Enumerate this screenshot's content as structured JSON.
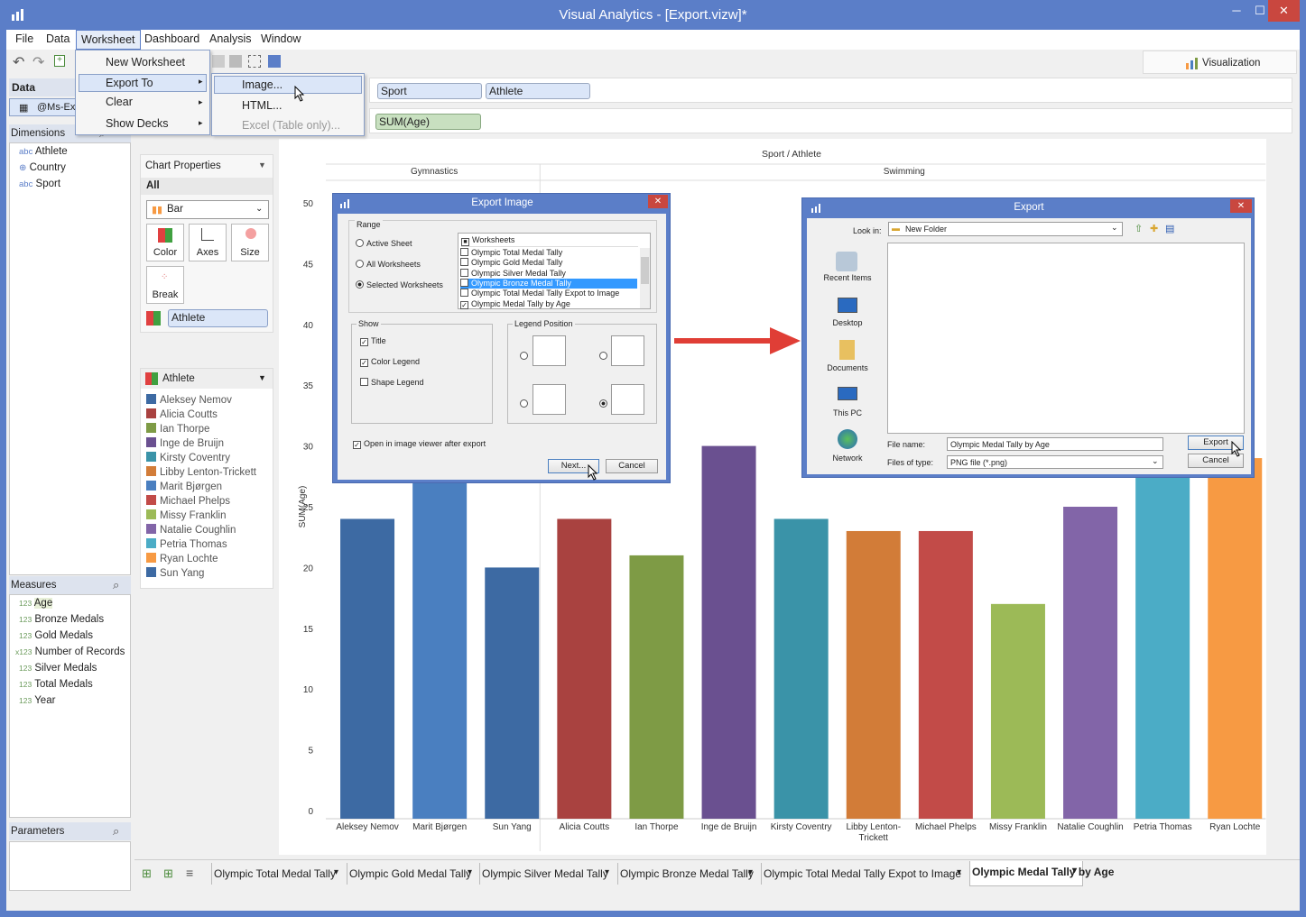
{
  "window": {
    "title": "Visual Analytics - [Export.vizw]*",
    "min": "─",
    "max": "☐",
    "close": "✕"
  },
  "menubar": [
    "File",
    "Data",
    "Worksheet",
    "Dashboard",
    "Analysis",
    "Window"
  ],
  "worksheet_menu": {
    "items": [
      "New Worksheet",
      "Export To",
      "Clear",
      "Show Decks"
    ]
  },
  "export_submenu": {
    "items": [
      "Image...",
      "HTML...",
      "Excel (Table only)..."
    ]
  },
  "visualization_tab": "Visualization",
  "data_panel": {
    "title": "Data",
    "source": "@Ms-Exc"
  },
  "dimensions": {
    "title": "Dimensions",
    "items": [
      {
        "prefix": "abc",
        "label": "Athlete"
      },
      {
        "prefix": "⊕",
        "label": "Country"
      },
      {
        "prefix": "abc",
        "label": "Sport"
      }
    ]
  },
  "measures": {
    "title": "Measures",
    "items": [
      {
        "prefix": "123",
        "label": "Age"
      },
      {
        "prefix": "123",
        "label": "Bronze Medals"
      },
      {
        "prefix": "123",
        "label": "Gold Medals"
      },
      {
        "prefix": "x123",
        "label": "Number of Records"
      },
      {
        "prefix": "123",
        "label": "Silver Medals"
      },
      {
        "prefix": "123",
        "label": "Total Medals"
      },
      {
        "prefix": "123",
        "label": "Year"
      }
    ]
  },
  "parameters": {
    "title": "Parameters"
  },
  "shelves": {
    "columns": [
      "Sport",
      "Athlete"
    ],
    "rows": [
      "SUM(Age)"
    ]
  },
  "chart_properties": {
    "title": "Chart Properties",
    "all": "All",
    "chart_type": "Bar",
    "buttons": [
      "Color",
      "Axes",
      "Size",
      "Break"
    ],
    "color_field": "Athlete"
  },
  "legend": {
    "title": "Athlete",
    "items": [
      {
        "name": "Aleksey Nemov",
        "color": "#3d6aa3"
      },
      {
        "name": "Alicia Coutts",
        "color": "#a94240"
      },
      {
        "name": "Ian Thorpe",
        "color": "#7e9b45"
      },
      {
        "name": "Inge de Bruijn",
        "color": "#6a5090"
      },
      {
        "name": "Kirsty Coventry",
        "color": "#3a93a8"
      },
      {
        "name": "Libby Lenton-Trickett",
        "color": "#d27c38"
      },
      {
        "name": "Marit Bjørgen",
        "color": "#4a7fc0"
      },
      {
        "name": "Michael Phelps",
        "color": "#c24b48"
      },
      {
        "name": "Missy Franklin",
        "color": "#9cba57"
      },
      {
        "name": "Natalie Coughlin",
        "color": "#8265a8"
      },
      {
        "name": "Petria Thomas",
        "color": "#4bacc6"
      },
      {
        "name": "Ryan Lochte",
        "color": "#f79a43"
      },
      {
        "name": "Sun Yang",
        "color": "#3d6aa3"
      }
    ]
  },
  "chart_data": {
    "type": "bar",
    "title": "Sport / Athlete",
    "groups": [
      {
        "name": "Gymnastics",
        "count": 3
      },
      {
        "name": "Swimming",
        "count": 10
      }
    ],
    "categories": [
      "Aleksey Nemov",
      "Marit Bjørgen",
      "Sun Yang",
      "Alicia Coutts",
      "Ian Thorpe",
      "Inge de Bruijn",
      "Kirsty Coventry",
      "Libby Lenton-Trickett",
      "Michael Phelps",
      "Missy Franklin",
      "Natalie Coughlin",
      "Petria Thomas",
      "Ryan Lochte"
    ],
    "values": [
      24,
      28,
      20,
      24,
      21,
      30,
      24,
      23,
      23,
      17,
      25,
      28,
      29
    ],
    "colors": [
      "#3d6aa3",
      "#4a7fc0",
      "#3d6aa3",
      "#a94240",
      "#7e9b45",
      "#6a5090",
      "#3a93a8",
      "#d27c38",
      "#c24b48",
      "#9cba57",
      "#8265a8",
      "#4bacc6",
      "#f79a43"
    ],
    "ylabel": "SUM(Age)",
    "ylim": [
      0,
      50
    ],
    "yticks": [
      0,
      5,
      10,
      15,
      20,
      25,
      30,
      35,
      40,
      45,
      50
    ]
  },
  "export_image_dialog": {
    "title": "Export Image",
    "range_label": "Range",
    "range_options": [
      "Active Sheet",
      "All Worksheets",
      "Selected Worksheets"
    ],
    "worksheets_header": "Worksheets",
    "worksheets": [
      {
        "name": "Olympic Total Medal Tally",
        "checked": false
      },
      {
        "name": "Olympic Gold Medal Tally",
        "checked": false
      },
      {
        "name": "Olympic Silver Medal Tally",
        "checked": false
      },
      {
        "name": "Olympic Bronze Medal Tally",
        "checked": false,
        "selected": true
      },
      {
        "name": "Olympic Total Medal Tally Expot to Image",
        "checked": false
      },
      {
        "name": "Olympic Medal Tally by Age",
        "checked": true
      }
    ],
    "show_label": "Show",
    "show_options": [
      {
        "label": "Title",
        "checked": true
      },
      {
        "label": "Color Legend",
        "checked": true
      },
      {
        "label": "Shape Legend",
        "checked": false
      }
    ],
    "legend_position_label": "Legend Position",
    "open_viewer": "Open in image viewer after export",
    "next": "Next...",
    "cancel": "Cancel"
  },
  "export_dialog": {
    "title": "Export",
    "look_in_label": "Look in:",
    "look_in_value": "New Folder",
    "places": [
      "Recent Items",
      "Desktop",
      "Documents",
      "This PC",
      "Network"
    ],
    "file_name_label": "File name:",
    "file_name": "Olympic Medal Tally by Age",
    "file_type_label": "Files of type:",
    "file_type": "PNG file (*.png)",
    "export": "Export",
    "cancel": "Cancel"
  },
  "sheet_tabs": [
    "Olympic Total Medal Tally",
    "Olympic Gold Medal Tally",
    "Olympic Silver Medal Tally",
    "Olympic Bronze Medal Tally",
    "Olympic Total Medal Tally Expot to Image",
    "Olympic Medal Tally by Age"
  ]
}
